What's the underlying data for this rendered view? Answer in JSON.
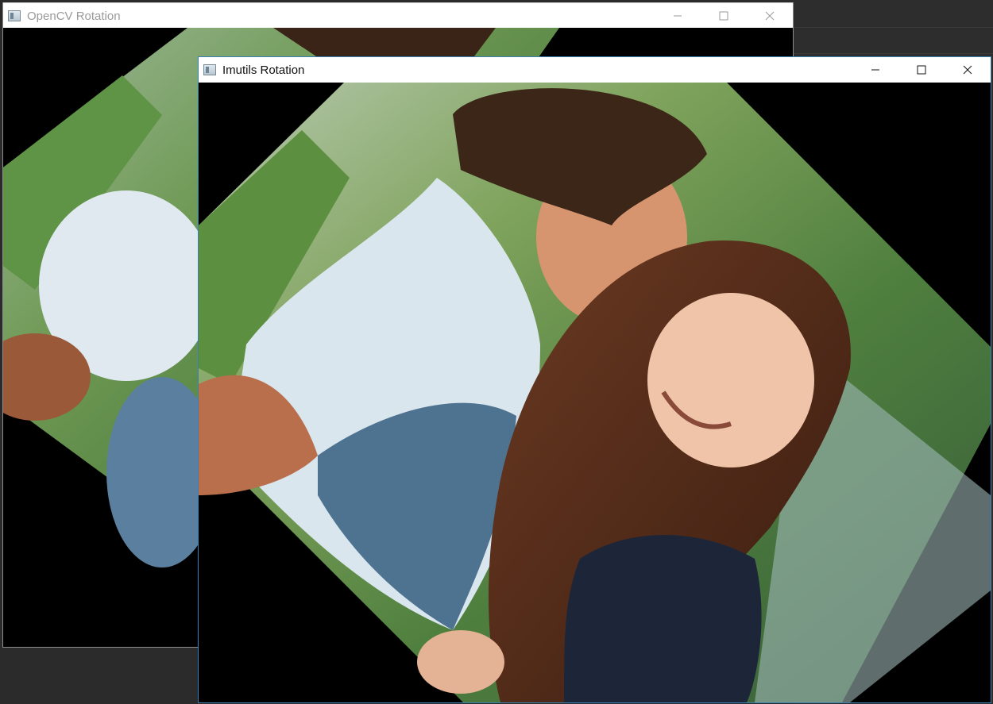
{
  "windows": {
    "back": {
      "title": "OpenCV Rotation",
      "image_alt": "Rotated photo of a smiling couple (OpenCV rotation, cropped corners)"
    },
    "front": {
      "title": "Imutils Rotation",
      "image_alt": "Rotated photo of a smiling couple (imutils rotate_bound, full image)"
    }
  },
  "icons": {
    "app": "app-window-icon",
    "minimize": "minimize-icon",
    "maximize": "maximize-icon",
    "close": "close-icon"
  },
  "colors": {
    "active_border": "#3c7fb1",
    "inactive_title": "#9a9a9a",
    "active_title": "#111111"
  }
}
